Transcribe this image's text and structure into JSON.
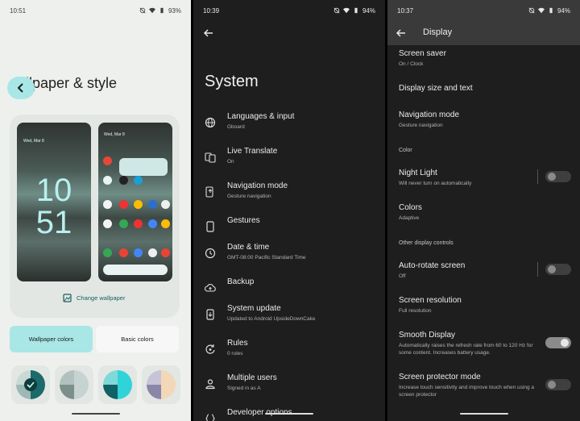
{
  "panel1": {
    "status_time": "10:51",
    "battery": "93%",
    "title": "llpaper & style",
    "lock_date": "Wed, Mar 8",
    "lock_clock_hour": "10",
    "lock_clock_min": "51",
    "home_date": "Wed, Mar 8",
    "change_wallpaper": "Change wallpaper",
    "tab_wallpaper_colors": "Wallpaper colors",
    "tab_basic_colors": "Basic colors",
    "accent": "#a8e7e6"
  },
  "panel2": {
    "status_time": "10:39",
    "battery": "94%",
    "title": "System",
    "items": [
      {
        "title": "Languages & input",
        "sub": "Gboard",
        "icon": "globe-icon"
      },
      {
        "title": "Live Translate",
        "sub": "On",
        "icon": "translate-icon"
      },
      {
        "title": "Navigation mode",
        "sub": "Gesture navigation",
        "icon": "gesture-icon"
      },
      {
        "title": "Gestures",
        "sub": "",
        "icon": "phone-icon"
      },
      {
        "title": "Date & time",
        "sub": "GMT-08:00 Pacific Standard Time",
        "icon": "clock-icon"
      },
      {
        "title": "Backup",
        "sub": "",
        "icon": "cloud-upload-icon"
      },
      {
        "title": "System update",
        "sub": "Updated to Android UpsideDownCake",
        "icon": "system-update-icon"
      },
      {
        "title": "Rules",
        "sub": "0 rules",
        "icon": "rules-icon"
      },
      {
        "title": "Multiple users",
        "sub": "Signed in as A",
        "icon": "person-icon"
      },
      {
        "title": "Developer options",
        "sub": "",
        "icon": "code-icon"
      }
    ]
  },
  "panel3": {
    "status_time": "10:37",
    "battery": "94%",
    "title": "Display",
    "screen_saver": {
      "title": "Screen saver",
      "sub": "On / Clock"
    },
    "display_size": {
      "title": "Display size and text"
    },
    "nav_mode": {
      "title": "Navigation mode",
      "sub": "Gesture navigation"
    },
    "section_color": "Color",
    "night_light": {
      "title": "Night Light",
      "sub": "Will never turn on automatically",
      "on": false
    },
    "colors": {
      "title": "Colors",
      "sub": "Adaptive"
    },
    "section_other": "Other display controls",
    "auto_rotate": {
      "title": "Auto-rotate screen",
      "sub": "Off",
      "on": false
    },
    "resolution": {
      "title": "Screen resolution",
      "sub": "Full resolution"
    },
    "smooth": {
      "title": "Smooth Display",
      "sub": "Automatically raises the refresh rate from 60 to 120 Hz for some content. Increases battery usage.",
      "on": true
    },
    "protector": {
      "title": "Screen protector mode",
      "sub": "Increase touch sensitivity and improve touch when using a screen protector",
      "on": false
    }
  }
}
